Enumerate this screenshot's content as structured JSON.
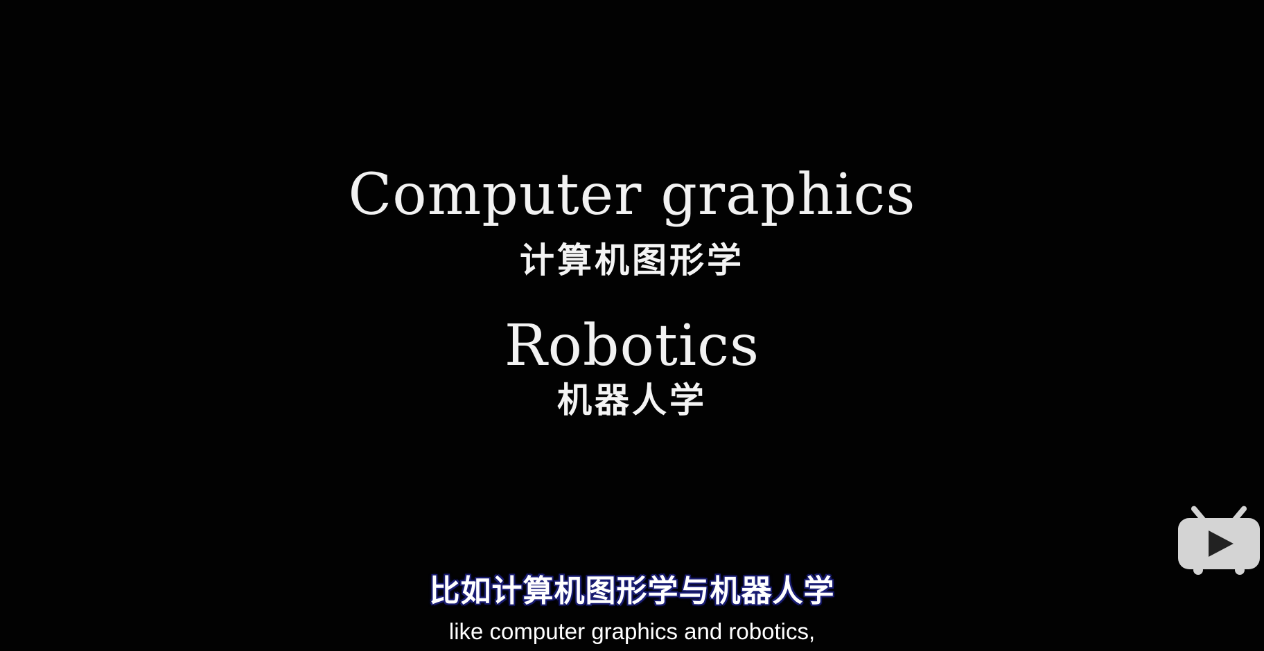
{
  "video": {
    "terms": [
      {
        "english": "Computer graphics",
        "chinese": "计算机图形学"
      },
      {
        "english": "Robotics",
        "chinese": "机器人学"
      }
    ],
    "subtitle": {
      "chinese": "比如计算机图形学与机器人学",
      "english": "like computer graphics and robotics,"
    },
    "watermark_icon": "tv-play-icon",
    "colors": {
      "background": "#020202",
      "text": "#f2f2f2",
      "subtitle_outline": "#1a1d6e",
      "watermark": "#e6e6e6"
    }
  }
}
